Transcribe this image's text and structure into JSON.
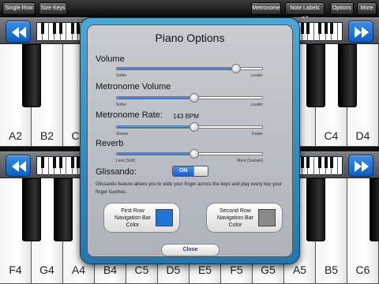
{
  "toolbar": {
    "single_row": "Single Row",
    "size_keys": "Size Keys",
    "metronome": "Metronome",
    "note_labels": "Note Labels Off",
    "options": "Options",
    "more": "More"
  },
  "top_row": {
    "nav_color": "#1f74d8",
    "white_keys": [
      "A2",
      "B2",
      "C3",
      "",
      "",
      "",
      "",
      "",
      "",
      "",
      "C4",
      "D4",
      "E4"
    ]
  },
  "bottom_row": {
    "nav_color": "#8a8a8a",
    "white_keys": [
      "F4",
      "G4",
      "A4",
      "B4",
      "C5",
      "D5",
      "E5",
      "F5",
      "G5",
      "A5",
      "B5",
      "C6"
    ]
  },
  "dialog": {
    "title": "Piano Options",
    "volume": {
      "label": "Volume",
      "min": "Softer",
      "max": "Louder",
      "value": 0.82
    },
    "metronome_volume": {
      "label": "Metronome Volume",
      "min": "Softer",
      "max": "Louder",
      "value": 0.53
    },
    "metronome_rate": {
      "label": "Metronome Rate:",
      "value_text": "143 BPM",
      "min": "Slower",
      "max": "Faster",
      "value": 0.53
    },
    "reverb": {
      "label": "Reverb",
      "min": "Less (Soft)",
      "max": "More (Sustain)",
      "value": 0.53
    },
    "glissando": {
      "label": "Glissando:",
      "state": "ON",
      "description": "Glissando feature allows you to slide your finger across the keys and play every key your finger touches."
    },
    "first_row_color": {
      "label": "First Row Navigation Bar Color",
      "color": "#1f74d8"
    },
    "second_row_color": {
      "label": "Second Row Navigation Bar Color",
      "color": "#8a8a8a"
    },
    "close": "Close"
  }
}
